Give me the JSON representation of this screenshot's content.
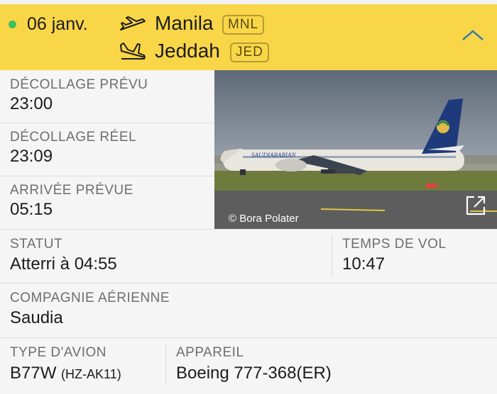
{
  "flight": {
    "date": "06 janv.",
    "departure_city": "Manila",
    "departure_code": "MNL",
    "arrival_city": "Jeddah",
    "arrival_code": "JED"
  },
  "details": {
    "sched_dep_label": "DÉCOLLAGE PRÉVU",
    "sched_dep_value": "23:00",
    "actual_dep_label": "DÉCOLLAGE RÉEL",
    "actual_dep_value": "23:09",
    "sched_arr_label": "ARRIVÉE PRÉVUE",
    "sched_arr_value": "05:15",
    "status_label": "STATUT",
    "status_value": "Atterri à 04:55",
    "flight_time_label": "TEMPS DE VOL",
    "flight_time_value": "10:47",
    "airline_label": "COMPAGNIE AÉRIENNE",
    "airline_value": "Saudia",
    "aircraft_type_label": "TYPE D'AVION",
    "aircraft_type_value": "B77W",
    "aircraft_reg": "(HZ-AK11)",
    "aircraft_label": "APPAREIL",
    "aircraft_value": "Boeing 777-368(ER)"
  },
  "photo": {
    "credit": "© Bora Polater",
    "airline_livery_text": "SAUDIARABIAN"
  },
  "icons": {
    "status_dot": "status-dot",
    "departure": "takeoff-plane-icon",
    "arrival": "landing-plane-icon",
    "collapse": "chevron-up-icon",
    "open_photo": "external-link-icon"
  },
  "colors": {
    "header_bg": "#f9d648",
    "status_green": "#3fc15b",
    "chevron": "#3b7fa8",
    "panel_bg": "#f5f5f5"
  }
}
